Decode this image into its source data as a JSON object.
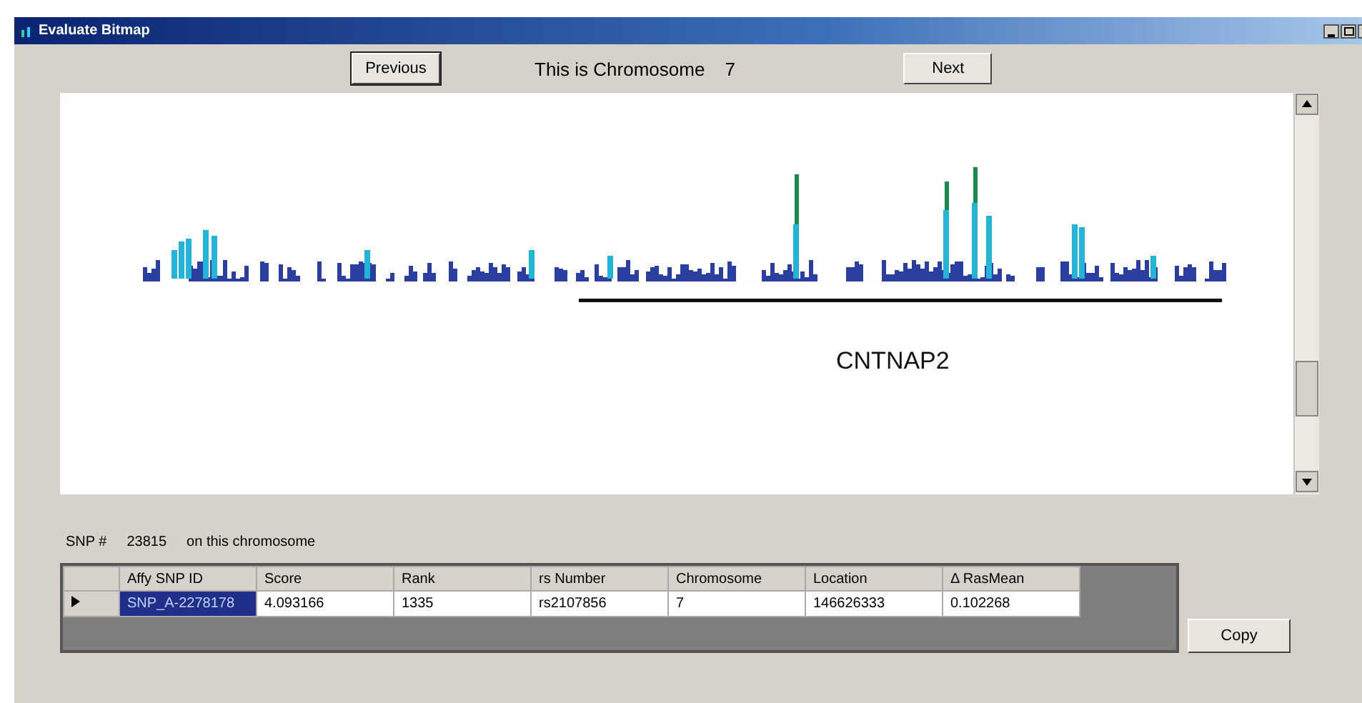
{
  "window": {
    "title": "Evaluate Bitmap"
  },
  "nav": {
    "previous": "Previous",
    "chromosome_label": "This is Chromosome",
    "chromosome_value": "7",
    "next": "Next"
  },
  "plot": {
    "gene_label": "CNTNAP2"
  },
  "snp_count": {
    "label": "SNP #",
    "value": "23815",
    "suffix": "on this chromosome"
  },
  "table": {
    "columns": [
      "Affy SNP ID",
      "Score",
      "Rank",
      "rs Number",
      "Chromosome",
      "Location",
      "Δ RasMean"
    ],
    "rows": [
      {
        "current": true,
        "cells": [
          {
            "text": "SNP_A-2278178",
            "selected": true
          },
          {
            "text": "4.093166",
            "selected": false
          },
          {
            "text": "1335",
            "selected": false
          },
          {
            "text": "rs2107856",
            "selected": false
          },
          {
            "text": "7",
            "selected": false
          },
          {
            "text": "146626333",
            "selected": false
          },
          {
            "text": "0.102268",
            "selected": false
          }
        ]
      }
    ]
  },
  "buttons": {
    "copy": "Copy"
  }
}
